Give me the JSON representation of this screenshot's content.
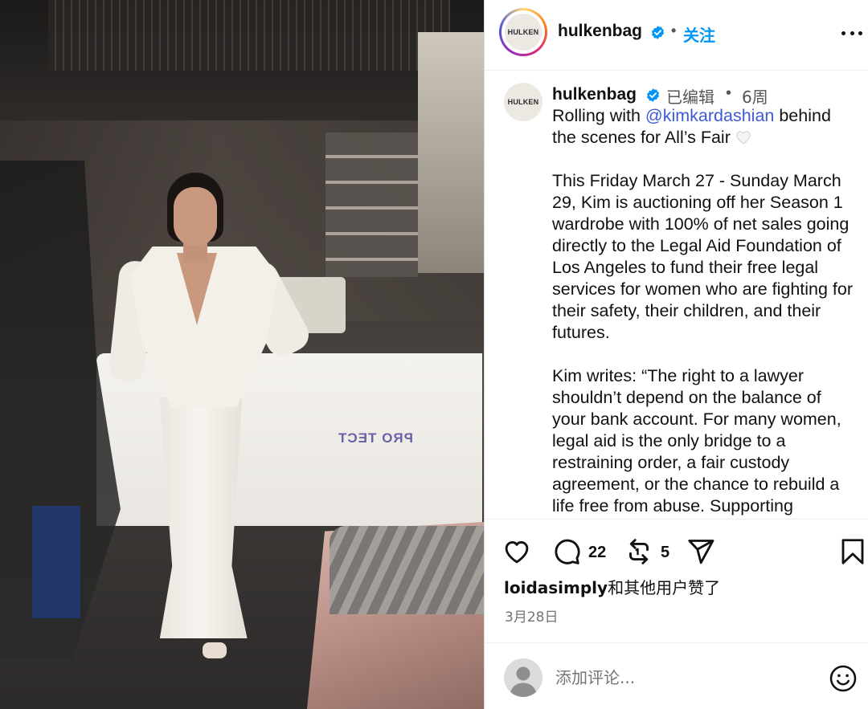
{
  "post": {
    "author": "hulkenbag",
    "avatar_text": "HULKEN",
    "follow_label": "关注",
    "separator": "•",
    "edited_label": "已编辑",
    "age": "6周",
    "caption_intro_before": "Rolling with ",
    "caption_mention": "@kimkardashian",
    "caption_intro_after": " behind the scenes for All’s Fair",
    "caption_p2": "This Friday March 27 - Sunday March 29, Kim is auctioning off her Season 1 wardrobe with 100% of net sales going directly to the Legal Aid Foundation of Los Angeles to fund their free legal services for women who are fighting for their safety, their children, and their futures.",
    "caption_p3": "Kim writes: “The right to a lawyer shouldn’t depend on the balance of your bank account. For many women, legal aid is the only bridge to a restraining order, a fair custody agreement, or the chance to rebuild a life free from abuse. Supporting",
    "photo_overlay_text": "PRO TECT"
  },
  "actions": {
    "comment_count": "22",
    "repost_count": "5"
  },
  "likes": {
    "user": "loidasimply",
    "rest": "和其他用户赞了"
  },
  "date": "3月28日",
  "comment": {
    "placeholder": "添加评论..."
  },
  "colors": {
    "accent": "#0095f6",
    "verified": "#0095f6",
    "mention": "#3d5ad6",
    "muted": "#737373"
  },
  "icons": [
    "verified-badge-icon",
    "more-options-icon",
    "heart-icon",
    "comment-icon",
    "repost-icon",
    "share-icon",
    "bookmark-icon",
    "emoji-icon",
    "white-heart-emoji"
  ]
}
